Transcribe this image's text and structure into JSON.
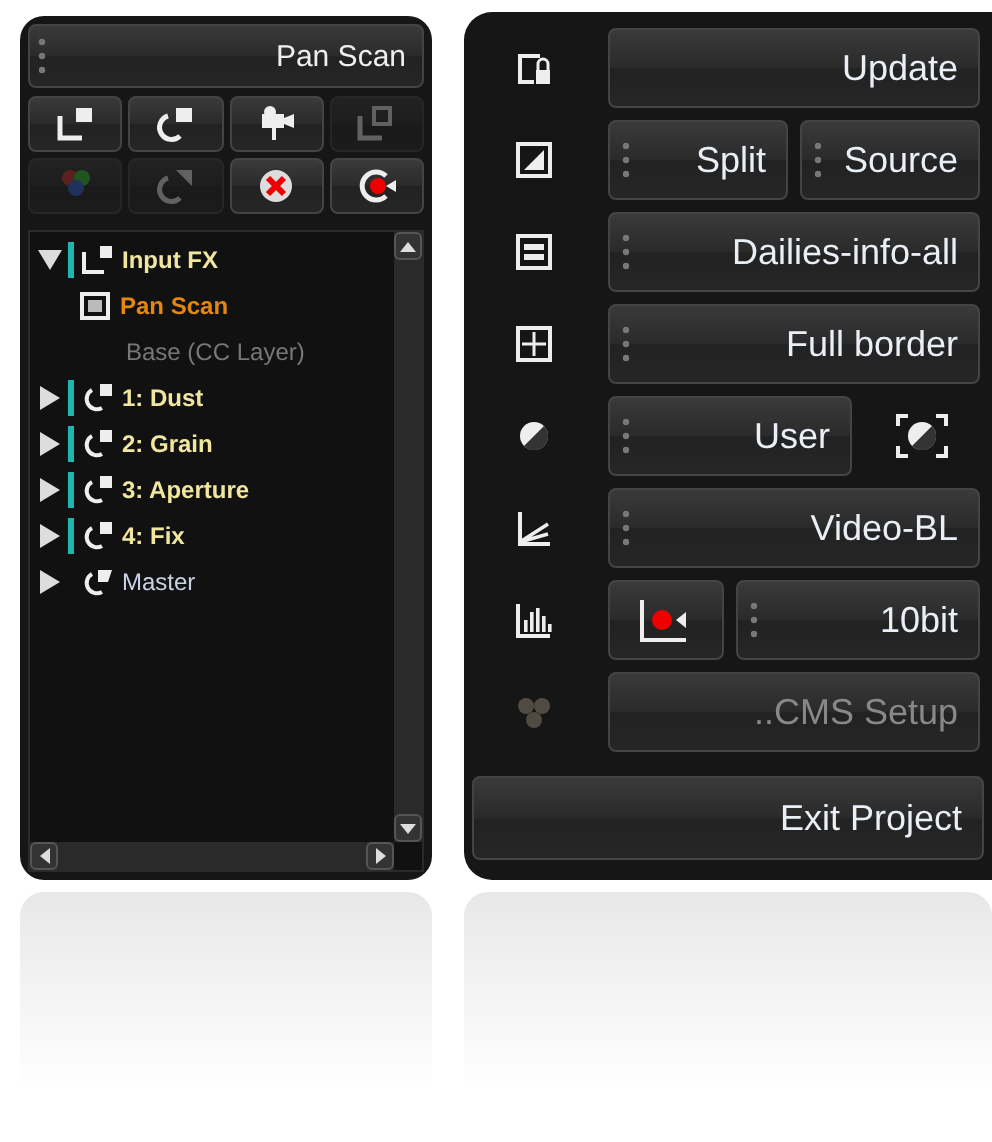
{
  "left_panel": {
    "title": "Pan Scan",
    "toolbar": [
      {
        "kind": "layeradd",
        "disabled": false
      },
      {
        "kind": "nodeadd",
        "disabled": false
      },
      {
        "kind": "camera",
        "disabled": false
      },
      {
        "kind": "layercopy",
        "disabled": true
      },
      {
        "kind": "rgb",
        "disabled": true
      },
      {
        "kind": "nodecopy",
        "disabled": true
      },
      {
        "kind": "delete",
        "disabled": false
      },
      {
        "kind": "record",
        "disabled": false
      }
    ],
    "tree": [
      {
        "label": "Input FX",
        "kind": "layer",
        "expanded": true,
        "children": [
          {
            "label": "Pan Scan",
            "kind": "effect",
            "selected": true,
            "disabled": false
          },
          {
            "label": "Base (CC Layer)",
            "kind": "base",
            "selected": false,
            "disabled": true
          }
        ]
      },
      {
        "label": "1: Dust",
        "kind": "node",
        "expanded": false
      },
      {
        "label": "2: Grain",
        "kind": "node",
        "expanded": false
      },
      {
        "label": "3: Aperture",
        "kind": "node",
        "expanded": false
      },
      {
        "label": "4: Fix",
        "kind": "node",
        "expanded": false
      },
      {
        "label": "Master",
        "kind": "master",
        "expanded": false
      }
    ]
  },
  "right_panel": {
    "rows": [
      {
        "kind": "lock",
        "disabled": false,
        "controls": [
          {
            "kind": "button",
            "label": "Update",
            "grip": false,
            "disabled": false
          }
        ]
      },
      {
        "kind": "split",
        "disabled": false,
        "controls": [
          {
            "kind": "button",
            "label": "Split",
            "grip": true,
            "disabled": false
          },
          {
            "kind": "button",
            "label": "Source",
            "grip": true,
            "disabled": false
          }
        ]
      },
      {
        "kind": "info",
        "disabled": false,
        "controls": [
          {
            "kind": "button",
            "label": "Dailies-info-all",
            "grip": true,
            "disabled": false
          }
        ]
      },
      {
        "kind": "border",
        "disabled": false,
        "controls": [
          {
            "kind": "button",
            "label": "Full border",
            "grip": true,
            "disabled": false
          }
        ]
      },
      {
        "kind": "gamma",
        "disabled": false,
        "controls": [
          {
            "kind": "button",
            "label": "User",
            "grip": true,
            "disabled": false
          },
          {
            "kind": "gammaframe"
          }
        ]
      },
      {
        "kind": "scope",
        "disabled": false,
        "controls": [
          {
            "kind": "button",
            "label": "Video-BL",
            "grip": true,
            "disabled": false
          }
        ]
      },
      {
        "kind": "histogram",
        "disabled": false,
        "controls": [
          {
            "kind": "record"
          },
          {
            "kind": "button",
            "label": "10bit",
            "grip": true,
            "disabled": false
          }
        ]
      },
      {
        "kind": "cms",
        "disabled": true,
        "controls": [
          {
            "kind": "button",
            "label": "..CMS Setup",
            "grip": false,
            "disabled": true
          }
        ]
      }
    ],
    "exit": {
      "label": "Exit Project"
    }
  }
}
